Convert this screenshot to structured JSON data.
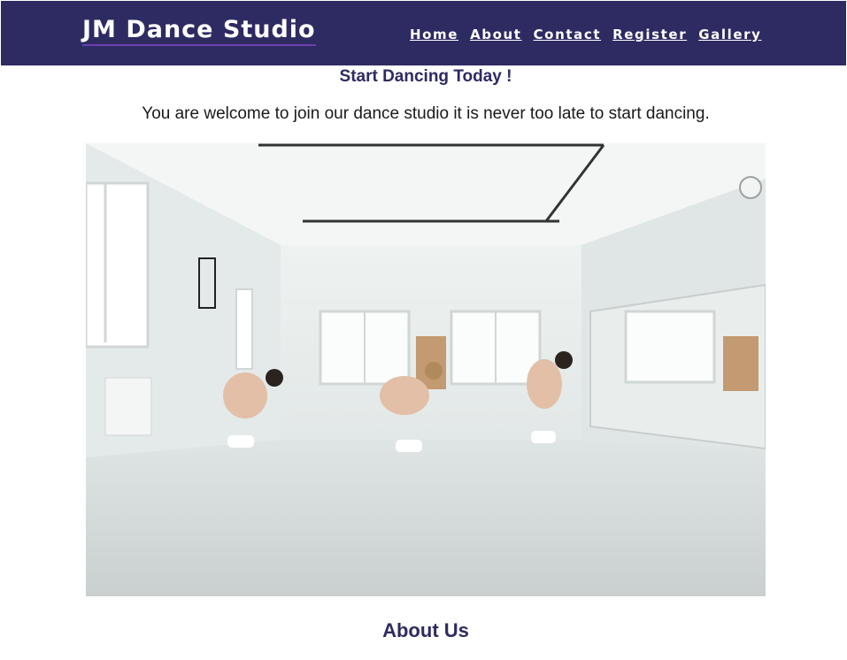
{
  "header": {
    "logo": "JM Dance Studio",
    "nav": [
      "Home",
      "About",
      "Contact",
      "Register",
      "Gallery"
    ]
  },
  "main": {
    "tagline": "Start Dancing Today !",
    "welcome": "You are welcome to join our dance studio it is never too late to start dancing.",
    "hero_image": "dance-studio-photo",
    "about_heading": "About Us"
  },
  "colors": {
    "header_bg": "#2e2a62",
    "accent_text": "#2e2a62"
  }
}
